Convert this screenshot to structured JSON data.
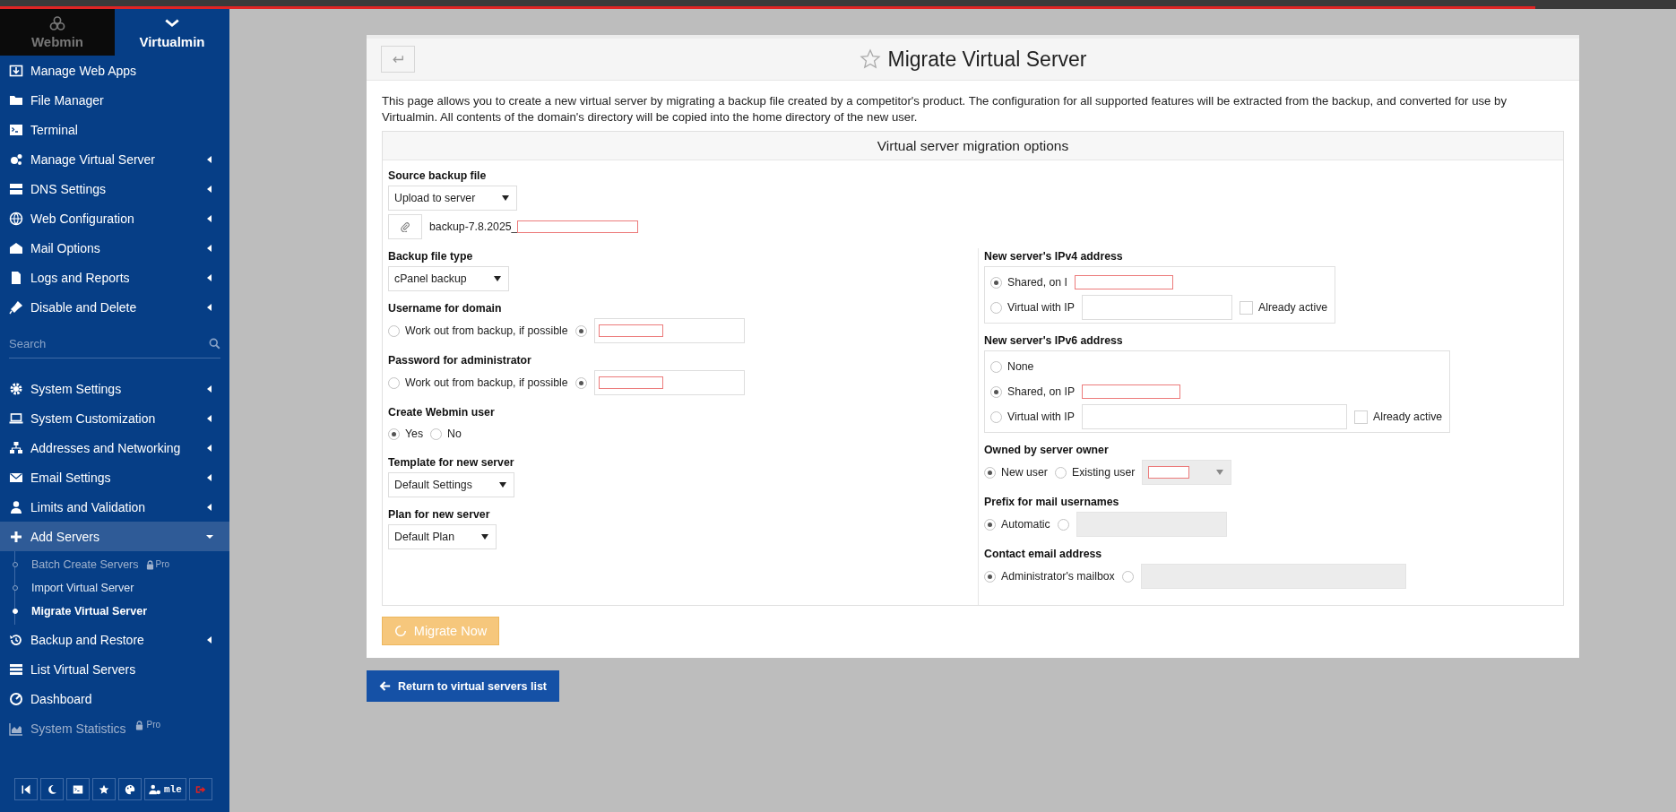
{
  "loading_bar": {
    "level": 0.916
  },
  "sidebar": {
    "tabs": [
      {
        "label": "Webmin",
        "selected": false
      },
      {
        "label": "Virtualmin",
        "selected": true
      }
    ],
    "menu_top": [
      {
        "label": "Manage Web Apps",
        "has_submenu": false,
        "expanded": false,
        "disabled": false
      },
      {
        "label": "File Manager",
        "has_submenu": false,
        "expanded": false,
        "disabled": false
      },
      {
        "label": "Terminal",
        "has_submenu": false,
        "expanded": false,
        "disabled": false
      },
      {
        "label": "Manage Virtual Server",
        "has_submenu": true,
        "expanded": false,
        "disabled": false
      },
      {
        "label": "DNS Settings",
        "has_submenu": true,
        "expanded": false,
        "disabled": false
      },
      {
        "label": "Web Configuration",
        "has_submenu": true,
        "expanded": false,
        "disabled": false
      },
      {
        "label": "Mail Options",
        "has_submenu": true,
        "expanded": false,
        "disabled": false
      },
      {
        "label": "Logs and Reports",
        "has_submenu": true,
        "expanded": false,
        "disabled": false
      },
      {
        "label": "Disable and Delete",
        "has_submenu": true,
        "expanded": false,
        "disabled": false
      }
    ],
    "search": {
      "placeholder": "Search"
    },
    "menu_bottom": [
      {
        "label": "System Settings",
        "has_submenu": true,
        "expanded": false,
        "disabled": false
      },
      {
        "label": "System Customization",
        "has_submenu": true,
        "expanded": false,
        "disabled": false
      },
      {
        "label": "Addresses and Networking",
        "has_submenu": true,
        "expanded": false,
        "disabled": false
      },
      {
        "label": "Email Settings",
        "has_submenu": true,
        "expanded": false,
        "disabled": false
      },
      {
        "label": "Limits and Validation",
        "has_submenu": true,
        "expanded": false,
        "disabled": false
      },
      {
        "label": "Add Servers",
        "has_submenu": true,
        "expanded": true,
        "disabled": false,
        "children": [
          {
            "label": "Batch Create Servers",
            "selected": false,
            "disabled": true,
            "badge": "Pro"
          },
          {
            "label": "Import Virtual Server",
            "selected": false,
            "disabled": false
          },
          {
            "label": "Migrate Virtual Server",
            "selected": true,
            "disabled": false
          }
        ]
      },
      {
        "label": "Backup and Restore",
        "has_submenu": true,
        "expanded": false,
        "disabled": false
      },
      {
        "label": "List Virtual Servers",
        "has_submenu": false,
        "expanded": false,
        "disabled": false
      },
      {
        "label": "Dashboard",
        "has_submenu": false,
        "expanded": false,
        "disabled": false
      },
      {
        "label": "System Statistics",
        "has_submenu": false,
        "expanded": false,
        "disabled": true,
        "badge": "Pro"
      }
    ],
    "footer": {
      "user_label": "mle"
    }
  },
  "page": {
    "title": "Migrate Virtual Server",
    "favorite": false,
    "description": "This page allows you to create a new virtual server by migrating a backup file created by a competitor's product. The configuration for all supported features will be extracted from the backup, and converted for use by Virtualmin. All contents of the domain's directory will be copied into the home directory of the new user.",
    "section_title": "Virtual server migration options",
    "form": {
      "top": [
        {
          "label": "Source backup file",
          "boxed": false,
          "rows": [
            [
              {
                "kind": "select",
                "value": "Upload to server",
                "disabled": false,
                "redacted": false
              }
            ],
            [
              {
                "kind": "file",
                "value": "backup-7.8.2025_",
                "redacted": true
              }
            ]
          ]
        }
      ],
      "left": [
        {
          "label": "Backup file type",
          "boxed": false,
          "rows": [
            [
              {
                "kind": "select",
                "value": "cPanel backup",
                "disabled": false,
                "redacted": false
              }
            ]
          ]
        },
        {
          "label": "Username for domain",
          "boxed": false,
          "rows": [
            [
              {
                "kind": "radio",
                "label": "Work out from backup, if possible",
                "selected": false
              },
              {
                "kind": "radio",
                "selected": true
              },
              {
                "kind": "input",
                "disabled": false,
                "redacted": true
              }
            ]
          ]
        },
        {
          "label": "Password for administrator",
          "boxed": false,
          "rows": [
            [
              {
                "kind": "radio",
                "label": "Work out from backup, if possible",
                "selected": false
              },
              {
                "kind": "radio",
                "selected": true
              },
              {
                "kind": "input",
                "disabled": false,
                "redacted": true
              }
            ]
          ]
        },
        {
          "label": "Create Webmin user",
          "boxed": false,
          "rows": [
            [
              {
                "kind": "radio",
                "label": "Yes",
                "selected": true
              },
              {
                "kind": "radio",
                "label": "No",
                "selected": false
              }
            ]
          ]
        },
        {
          "label": "Template for new server",
          "boxed": false,
          "rows": [
            [
              {
                "kind": "select",
                "value": "Default Settings",
                "disabled": false,
                "redacted": false
              }
            ]
          ]
        },
        {
          "label": "Plan for new server",
          "boxed": false,
          "rows": [
            [
              {
                "kind": "select",
                "value": "Default Plan",
                "disabled": false,
                "redacted": false
              }
            ]
          ]
        }
      ],
      "right": [
        {
          "label": "New server's IPv4 address",
          "boxed": true,
          "rows": [
            [
              {
                "kind": "radio",
                "label": "Shared, on I",
                "selected": true
              },
              {
                "kind": "redaction"
              }
            ],
            [
              {
                "kind": "radio",
                "label": "Virtual with IP",
                "selected": false
              },
              {
                "kind": "input",
                "disabled": false,
                "redacted": false
              },
              {
                "kind": "checkbox",
                "label": "Already active",
                "checked": false
              }
            ]
          ]
        },
        {
          "label": "New server's IPv6 address",
          "boxed": true,
          "rows": [
            [
              {
                "kind": "radio",
                "label": "None",
                "selected": false
              }
            ],
            [
              {
                "kind": "radio",
                "label": "Shared, on IP",
                "selected": true
              },
              {
                "kind": "redaction"
              }
            ],
            [
              {
                "kind": "radio",
                "label": "Virtual with IP",
                "selected": false
              },
              {
                "kind": "input",
                "disabled": false,
                "redacted": false
              },
              {
                "kind": "checkbox",
                "label": "Already active",
                "checked": false
              }
            ]
          ]
        },
        {
          "label": "Owned by server owner",
          "boxed": false,
          "rows": [
            [
              {
                "kind": "radio",
                "label": "New user",
                "selected": true
              },
              {
                "kind": "radio",
                "label": "Existing user",
                "selected": false
              },
              {
                "kind": "select",
                "disabled": true,
                "redacted": true
              }
            ]
          ]
        },
        {
          "label": "Prefix for mail usernames",
          "boxed": false,
          "rows": [
            [
              {
                "kind": "radio",
                "label": "Automatic",
                "selected": true
              },
              {
                "kind": "radio",
                "selected": false
              },
              {
                "kind": "input",
                "disabled": true,
                "redacted": false
              }
            ]
          ]
        },
        {
          "label": "Contact email address",
          "boxed": false,
          "rows": [
            [
              {
                "kind": "radio",
                "label": "Administrator's mailbox",
                "selected": true
              },
              {
                "kind": "radio",
                "selected": false
              },
              {
                "kind": "input",
                "disabled": true,
                "redacted": false
              }
            ]
          ]
        }
      ]
    },
    "submit": {
      "label": "Migrate Now",
      "disabled": true
    },
    "return_button": {
      "label": "Return to virtual servers list"
    }
  }
}
